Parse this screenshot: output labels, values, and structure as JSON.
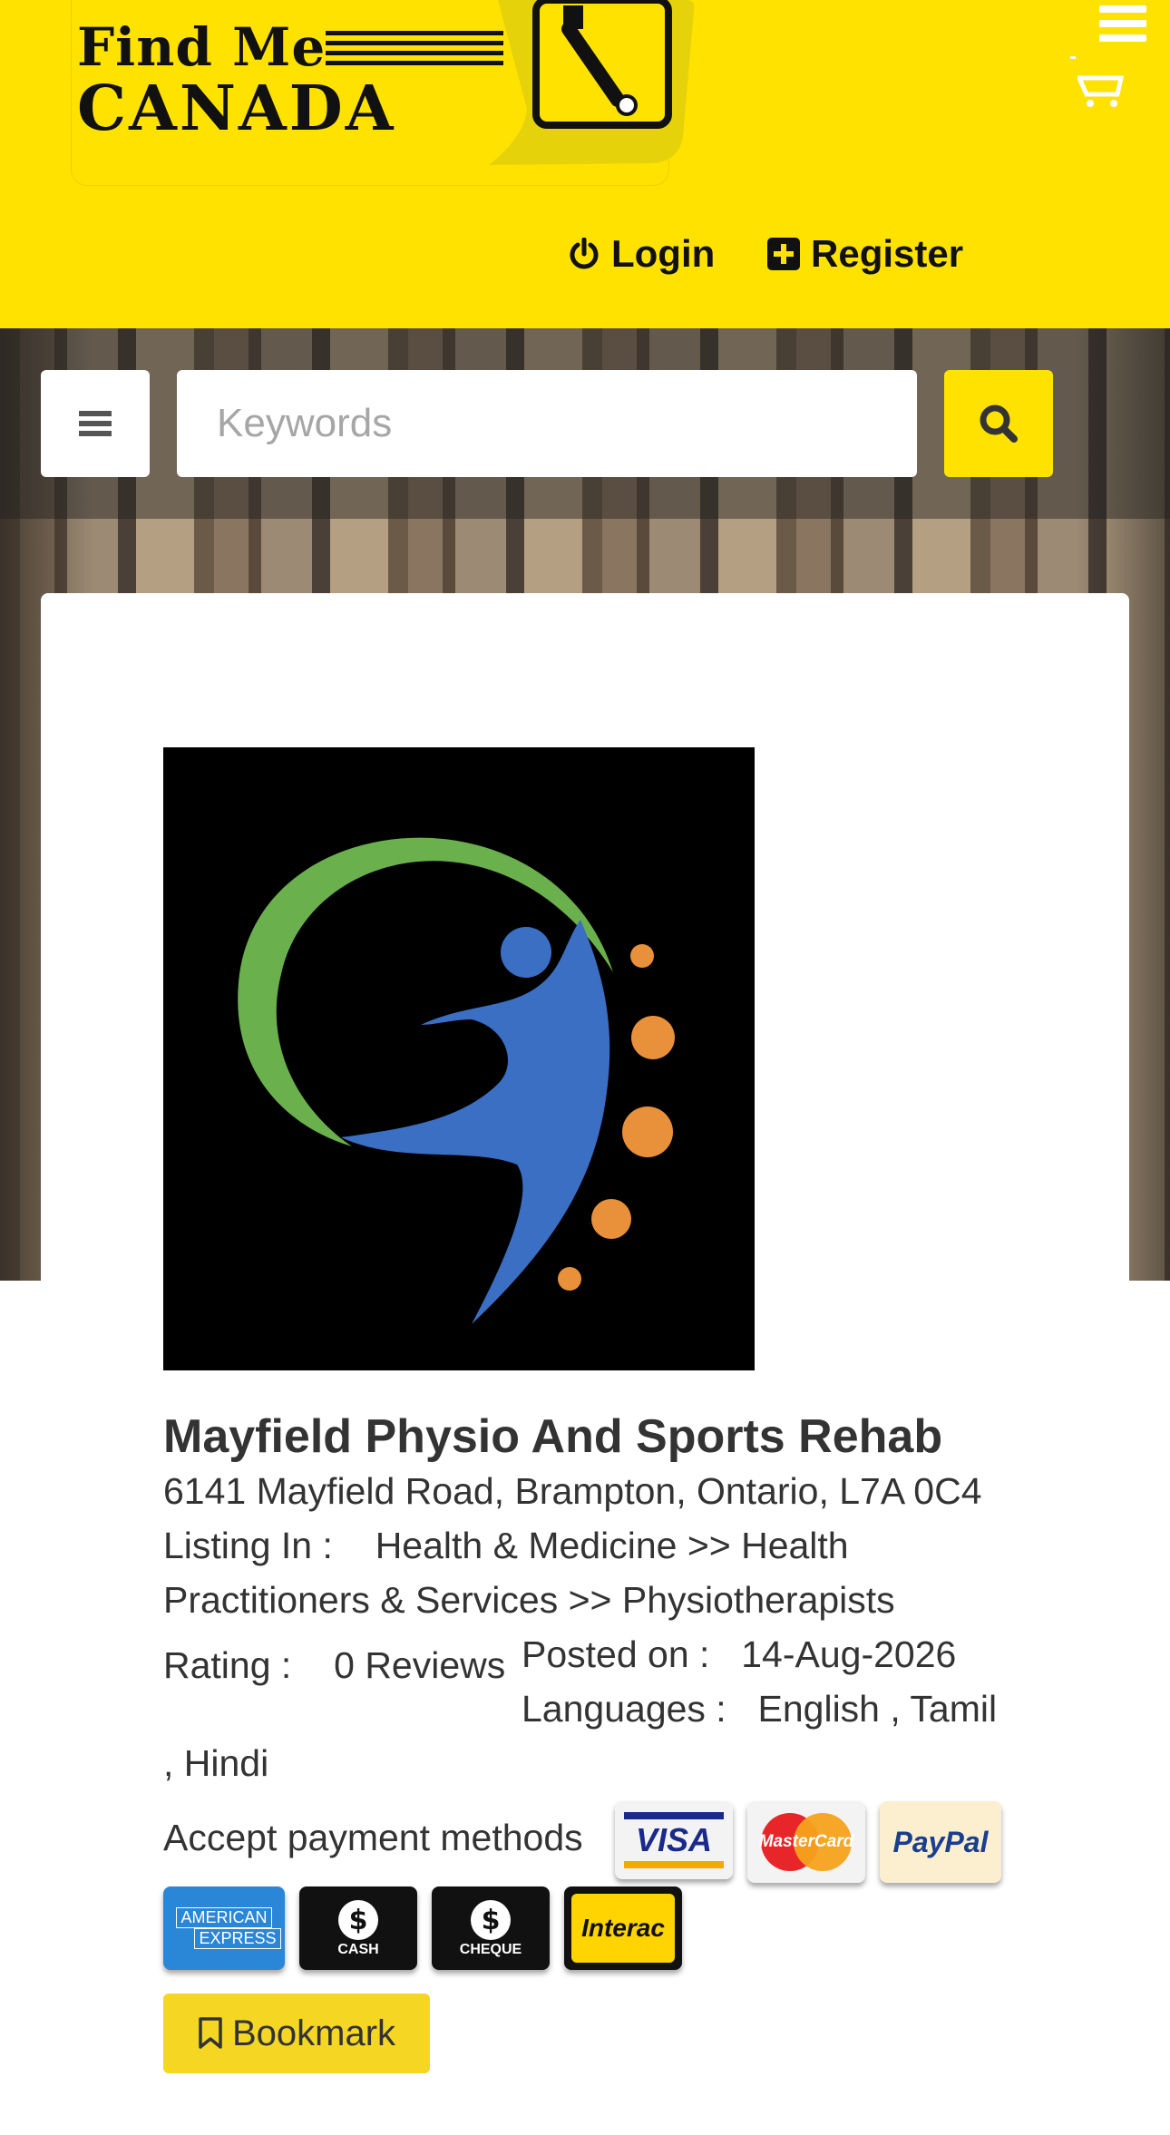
{
  "header": {
    "logo_line1": "Find Me",
    "logo_line2": "CANADA",
    "menu_icon": "hamburger-icon",
    "cart_icon": "cart-icon",
    "login_label": "Login",
    "login_icon": "power-icon",
    "register_label": "Register",
    "register_icon": "plus-square-icon",
    "background_color": "#ffe200"
  },
  "search": {
    "placeholder": "Keywords",
    "value": "",
    "menu_icon": "bars-icon",
    "search_icon": "search-icon"
  },
  "listing": {
    "name": "Mayfield Physio And Sports Rehab",
    "address": "6141 Mayfield Road, Brampton, Ontario, L7A 0C4",
    "listing_in_label": "Listing In :",
    "category_line1": "Health & Medicine >> Health",
    "category_line2": "Practitioners & Services >> Physiotherapists",
    "rating_label": "Rating :",
    "rating_value": "0 Reviews",
    "posted_label": "Posted on :",
    "posted_value": "14-Aug-2026",
    "languages_label": "Languages :",
    "languages_value": "English , Tamil",
    "languages_more": ", Hindi",
    "payment_label": "Accept payment methods",
    "payment_methods": [
      {
        "name": "VISA",
        "icon": "visa-icon"
      },
      {
        "name": "MasterCard",
        "icon": "mastercard-icon"
      },
      {
        "name": "PayPal",
        "icon": "paypal-icon"
      },
      {
        "name_line1": "AMERICAN",
        "name_line2": "EXPRESS",
        "icon": "amex-icon"
      },
      {
        "name": "CASH",
        "icon": "cash-icon"
      },
      {
        "name": "CHEQUE",
        "icon": "cheque-icon"
      },
      {
        "name": "Interac",
        "icon": "interac-icon"
      }
    ],
    "bookmark_label": "Bookmark",
    "bookmark_icon": "bookmark-icon"
  },
  "colors": {
    "accent_yellow": "#ffe200",
    "bookmark_yellow": "#f4d623",
    "text": "#333333",
    "logo_green": "#6ab04c",
    "logo_blue": "#3a6fc4",
    "logo_orange": "#e8913a"
  }
}
